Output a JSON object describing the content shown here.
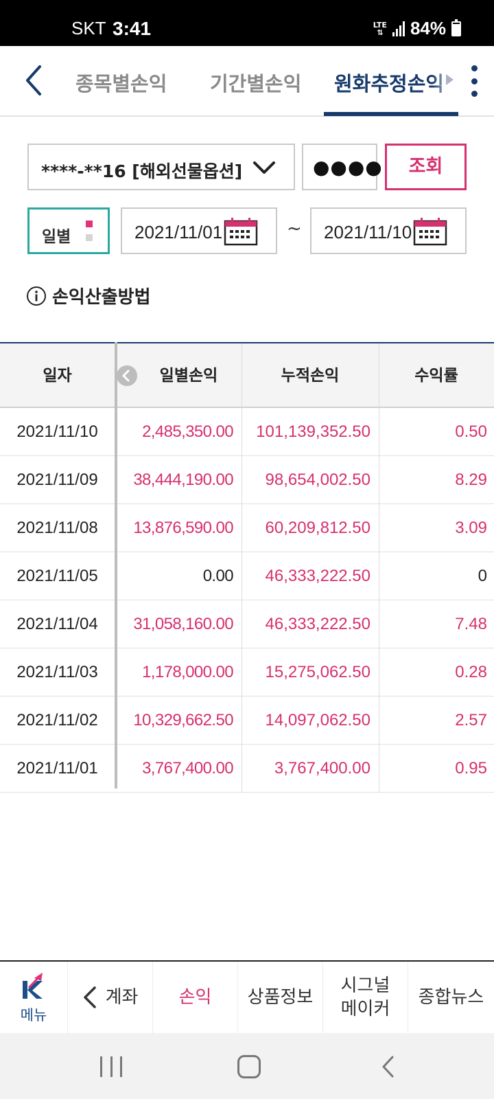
{
  "status_bar": {
    "carrier": "SKT",
    "time": "3:41",
    "network": "LTE",
    "battery_percent": "84%",
    "battery_level": 0.84
  },
  "top_nav": {
    "tabs": [
      {
        "label": "종목별손익",
        "active": false
      },
      {
        "label": "기간별손익",
        "active": false
      },
      {
        "label": "원화추정손익",
        "active": true
      }
    ]
  },
  "controls": {
    "account": "****-**16 [해외선물옵션]",
    "password_mask": "●●●●",
    "query_button": "조회",
    "period_type": "일별",
    "start_date": "2021/11/01",
    "end_date": "2021/11/10",
    "range_separator": "~",
    "calc_method_link": "손익산출방법"
  },
  "table": {
    "headers": [
      "일자",
      "일별손익",
      "누적손익",
      "수익률"
    ],
    "rows": [
      {
        "date": "2021/11/10",
        "daily": "2,485,350.00",
        "cumulative": "101,139,352.50",
        "rate": "0.50",
        "daily_pos": true,
        "rate_pos": true
      },
      {
        "date": "2021/11/09",
        "daily": "38,444,190.00",
        "cumulative": "98,654,002.50",
        "rate": "8.29",
        "daily_pos": true,
        "rate_pos": true
      },
      {
        "date": "2021/11/08",
        "daily": "13,876,590.00",
        "cumulative": "60,209,812.50",
        "rate": "3.09",
        "daily_pos": true,
        "rate_pos": true
      },
      {
        "date": "2021/11/05",
        "daily": "0.00",
        "cumulative": "46,333,222.50",
        "rate": "0",
        "daily_pos": false,
        "rate_pos": false
      },
      {
        "date": "2021/11/04",
        "daily": "31,058,160.00",
        "cumulative": "46,333,222.50",
        "rate": "7.48",
        "daily_pos": true,
        "rate_pos": true
      },
      {
        "date": "2021/11/03",
        "daily": "1,178,000.00",
        "cumulative": "15,275,062.50",
        "rate": "0.28",
        "daily_pos": true,
        "rate_pos": true
      },
      {
        "date": "2021/11/02",
        "daily": "10,329,662.50",
        "cumulative": "14,097,062.50",
        "rate": "2.57",
        "daily_pos": true,
        "rate_pos": true
      },
      {
        "date": "2021/11/01",
        "daily": "3,767,400.00",
        "cumulative": "3,767,400.00",
        "rate": "0.95",
        "daily_pos": true,
        "rate_pos": true
      }
    ]
  },
  "bottom_menu": {
    "menu_label": "메뉴",
    "items": [
      {
        "label": "계좌",
        "active": false
      },
      {
        "label": "손익",
        "active": true
      },
      {
        "label": "상품정보",
        "active": false
      },
      {
        "label": "시그널\n메이커",
        "active": false
      },
      {
        "label": "종합뉴스",
        "active": false
      }
    ]
  },
  "colors": {
    "primary_navy": "#173a6b",
    "profit_pink": "#d6306f",
    "teal_accent": "#2aa8a0"
  },
  "icons": [
    "back-arrow-icon",
    "tab-scroll-arrow-icon",
    "more-vert-icon",
    "chevron-down-icon",
    "calendar-icon",
    "info-icon",
    "scroll-left-icon",
    "k-logo-icon",
    "recent-apps-icon",
    "home-icon",
    "system-back-icon"
  ]
}
